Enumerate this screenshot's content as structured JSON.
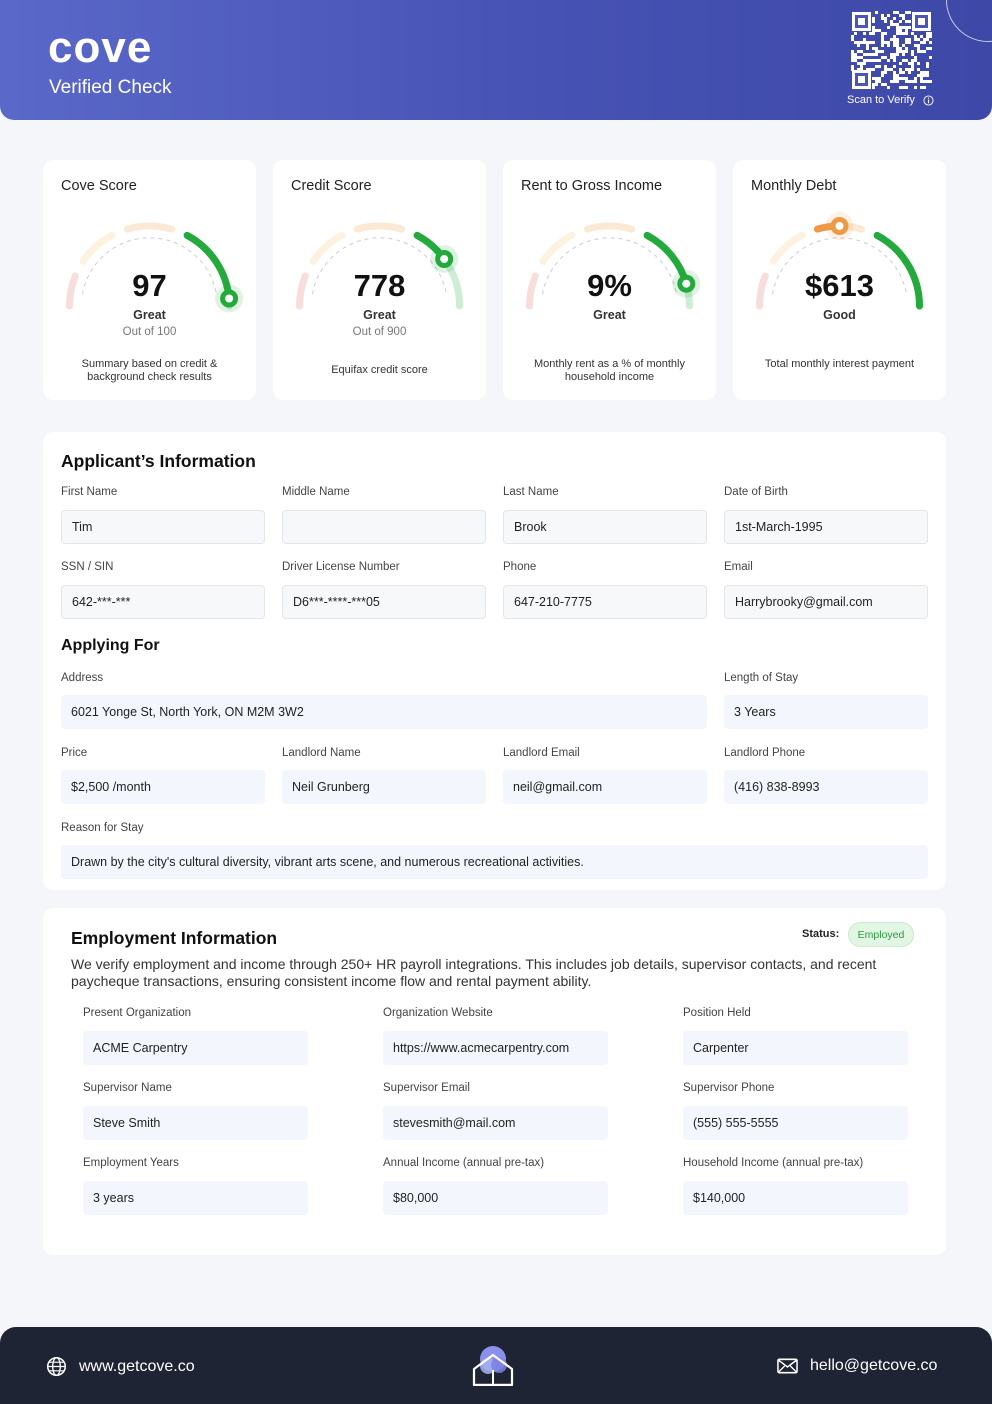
{
  "header": {
    "logo": "cove",
    "subtitle": "Verified Check",
    "scan_label": "Scan to Verify"
  },
  "scores": [
    {
      "title": "Cove Score",
      "value": "97",
      "rating": "Great",
      "out_of": "Out of 100",
      "description": "Summary based on credit & background check results",
      "level": 0.97
    },
    {
      "title": "Credit Score",
      "value": "778",
      "rating": "Great",
      "out_of": "Out of 900",
      "description": "Equifax credit score",
      "level": 0.8
    },
    {
      "title": "Rent to Gross Income",
      "value": "9%",
      "rating": "Great",
      "out_of": "",
      "description": "Monthly rent as a % of monthly household income",
      "level": 0.91
    },
    {
      "title": "Monthly Debt",
      "value": "$613",
      "rating": "Good",
      "out_of": "",
      "description": "Total monthly interest payment",
      "level": 0.5
    }
  ],
  "applicant": {
    "title": "Applicant’s Information",
    "fields": [
      {
        "label": "First Name",
        "value": "Tim"
      },
      {
        "label": "Middle Name",
        "value": ""
      },
      {
        "label": "Last Name",
        "value": "Brook"
      },
      {
        "label": "Date of Birth",
        "value": "1st-March-1995"
      },
      {
        "label": "SSN / SIN",
        "value": "642-***-***"
      },
      {
        "label": "Driver License Number",
        "value": "D6***-****-***05"
      },
      {
        "label": "Phone",
        "value": "647-210-7775"
      },
      {
        "label": "Email",
        "value": "Harrybrooky@gmail.com"
      }
    ]
  },
  "applying": {
    "title": "Applying For",
    "address": {
      "label": "Address",
      "value": "6021 Yonge St, North York, ON M2M 3W2"
    },
    "stay": {
      "label": "Length of Stay",
      "value": "3 Years"
    },
    "price": {
      "label": "Price",
      "value": "$2,500 /month"
    },
    "landlord_name": {
      "label": "Landlord Name",
      "value": "Neil Grunberg"
    },
    "landlord_email": {
      "label": "Landlord Email",
      "value": "neil@gmail.com"
    },
    "landlord_phone": {
      "label": "Landlord Phone",
      "value": "(416) 838-8993"
    },
    "reason": {
      "label": "Reason for Stay",
      "value": "Drawn by the city's cultural diversity, vibrant arts scene, and numerous recreational activities."
    }
  },
  "employment": {
    "title": "Employment Information",
    "status_label": "Status:",
    "status_value": "Employed",
    "description": "We verify employment and income through 250+ HR payroll integrations. This includes job details, supervisor contacts, and recent paycheque transactions, ensuring consistent income flow and rental payment ability.",
    "fields": [
      {
        "label": "Present Organization",
        "value": "ACME Carpentry"
      },
      {
        "label": "Organization Website",
        "value": "https://www.acmecarpentry.com"
      },
      {
        "label": "Position Held",
        "value": "Carpenter"
      },
      {
        "label": "Supervisor Name",
        "value": "Steve Smith"
      },
      {
        "label": "Supervisor Email",
        "value": "stevesmith@mail.com"
      },
      {
        "label": "Supervisor Phone",
        "value": "(555) 555-5555"
      },
      {
        "label": "Employment Years",
        "value": "3 years"
      },
      {
        "label": "Annual Income (annual pre-tax)",
        "value": "$80,000"
      },
      {
        "label": "Household Income (annual pre-tax)",
        "value": "$140,000"
      }
    ]
  },
  "footer": {
    "website": "www.getcove.co",
    "email": "hello@getcove.co"
  },
  "colors": {
    "header": "#4a56b8",
    "gauge_red": "#d9625d",
    "gauge_yellow": "#f2c66d",
    "gauge_orange": "#ec9a45",
    "gauge_green": "#23a93c",
    "footer": "#1e2433"
  }
}
